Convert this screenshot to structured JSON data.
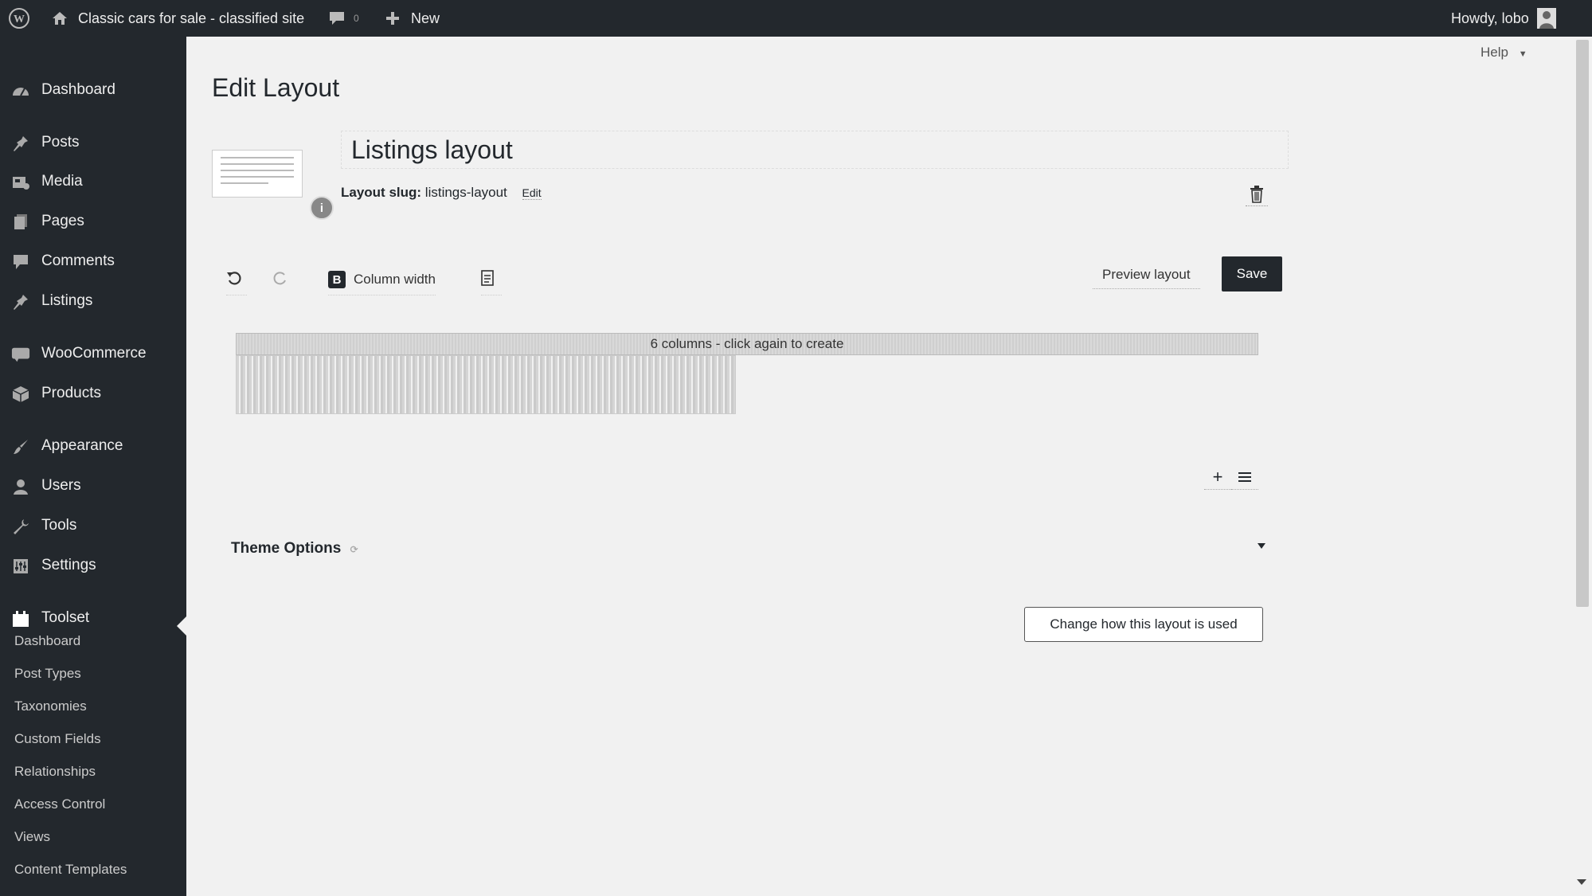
{
  "admin_bar": {
    "site_name": "Classic cars for sale - classified site",
    "comments_count": "0",
    "new_label": "New",
    "greeting": "Howdy, lobo",
    "icons": [
      "wordpress-logo-icon",
      "home-icon",
      "comment-bubble-icon",
      "plus-icon",
      "avatar-icon"
    ]
  },
  "sidebar": {
    "items": [
      {
        "label": "Dashboard",
        "icon": "dashboard-icon"
      },
      {
        "label": "Posts",
        "icon": "pin-icon"
      },
      {
        "label": "Media",
        "icon": "media-icon"
      },
      {
        "label": "Pages",
        "icon": "pages-icon"
      },
      {
        "label": "Comments",
        "icon": "comment-icon"
      },
      {
        "label": "Listings",
        "icon": "pin-icon"
      },
      {
        "label": "WooCommerce",
        "icon": "woocommerce-icon"
      },
      {
        "label": "Products",
        "icon": "products-icon"
      },
      {
        "label": "Appearance",
        "icon": "brush-icon"
      },
      {
        "label": "Users",
        "icon": "users-icon"
      },
      {
        "label": "Tools",
        "icon": "wrench-icon"
      },
      {
        "label": "Settings",
        "icon": "settings-icon"
      },
      {
        "label": "Toolset",
        "icon": "toolset-icon"
      }
    ],
    "submenu": [
      "Dashboard",
      "Post Types",
      "Taxonomies",
      "Custom Fields",
      "Relationships",
      "Access Control",
      "Views",
      "Content Templates"
    ]
  },
  "main": {
    "help_label": "Help",
    "page_title": "Edit Layout",
    "layout_title": "Listings layout",
    "slug_label": "Layout slug:",
    "slug_value": "listings-layout",
    "slug_edit": "Edit",
    "toolbar": {
      "column_width_label": "Column width",
      "bootstrap_badge": "B",
      "preview_label": "Preview layout",
      "save_label": "Save"
    },
    "grid": {
      "header_text": "6 columns - click again to create"
    },
    "theme_options_label": "Theme Options",
    "usage_button_label": "Change how this layout is used"
  },
  "colors": {
    "admin_bg": "#23282d",
    "content_bg": "#f1f1f1",
    "accent": "#23282d"
  }
}
